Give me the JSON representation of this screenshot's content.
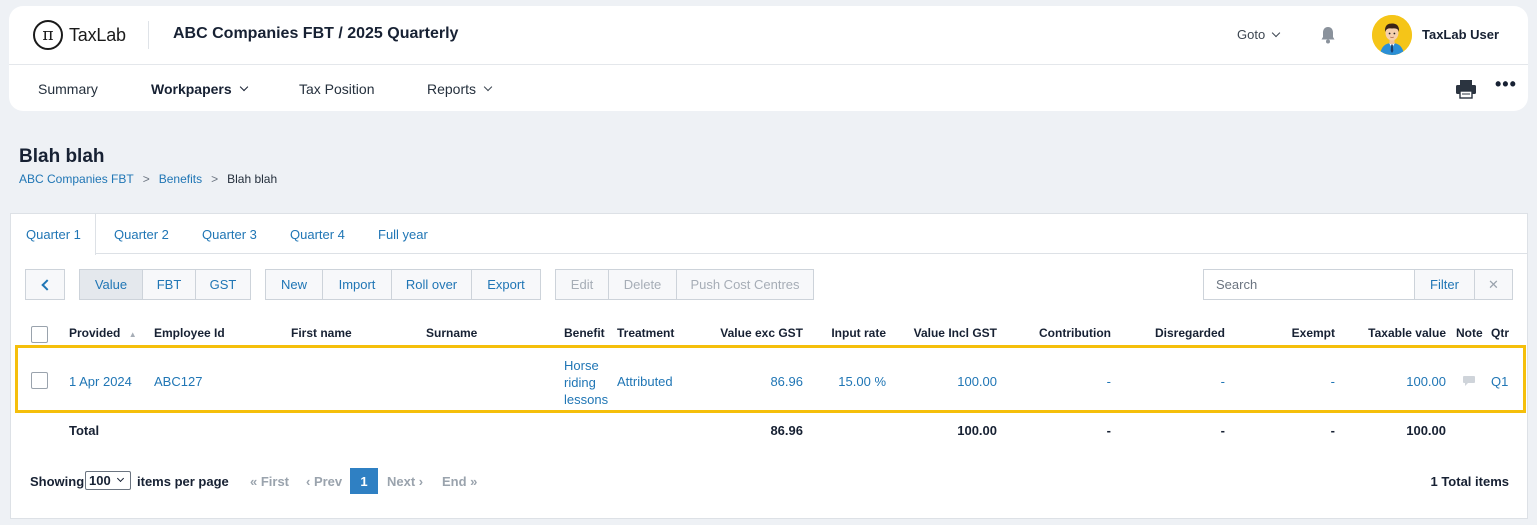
{
  "header": {
    "logo_text": "TaxLab",
    "title": "ABC Companies FBT / 2025 Quarterly",
    "goto_label": "Goto",
    "user_name": "TaxLab User"
  },
  "nav": {
    "items": [
      {
        "label": "Summary",
        "dropdown": false
      },
      {
        "label": "Workpapers",
        "dropdown": true,
        "active": true
      },
      {
        "label": "Tax Position",
        "dropdown": false
      },
      {
        "label": "Reports",
        "dropdown": true
      }
    ]
  },
  "page": {
    "title": "Blah blah",
    "breadcrumb": [
      "ABC Companies FBT",
      "Benefits",
      "Blah blah"
    ],
    "breadcrumb_sep": ">"
  },
  "tabs": [
    "Quarter 1",
    "Quarter 2",
    "Quarter 3",
    "Quarter 4",
    "Full year"
  ],
  "active_tab": "Quarter 1",
  "toolbar": {
    "view_buttons": [
      "Value",
      "FBT",
      "GST"
    ],
    "selected_view": "Value",
    "action_buttons": [
      "New",
      "Import",
      "Roll over",
      "Export"
    ],
    "disabled_buttons": [
      "Edit",
      "Delete",
      "Push Cost Centres"
    ],
    "search_placeholder": "Search",
    "filter_label": "Filter",
    "clear_label": "✕"
  },
  "table": {
    "columns": [
      "Provided",
      "Employee Id",
      "First name",
      "Surname",
      "Benefit",
      "Treatment",
      "Value exc GST",
      "Input rate",
      "Value Incl GST",
      "Contribution",
      "Disregarded",
      "Exempt",
      "Taxable value",
      "Note",
      "Qtr"
    ],
    "sort_column": "Provided",
    "rows": [
      {
        "provided": "1 Apr 2024",
        "employee_id": "ABC127",
        "first_name": "",
        "surname": "",
        "benefit": [
          "Horse",
          "riding",
          "lessons"
        ],
        "treatment": "Attributed",
        "value_exc_gst": "86.96",
        "input_rate": "15.00 %",
        "value_incl_gst": "100.00",
        "contribution": "-",
        "disregarded": "-",
        "exempt": "-",
        "taxable_value": "100.00",
        "qtr": "Q1"
      }
    ],
    "totals": {
      "label": "Total",
      "value_exc_gst": "86.96",
      "value_incl_gst": "100.00",
      "contribution": "-",
      "disregarded": "-",
      "exempt": "-",
      "taxable_value": "100.00"
    }
  },
  "pagination": {
    "showing_label": "Showing",
    "per_page_value": "100",
    "per_page_label": "items per page",
    "first": "« First",
    "prev": "‹ Prev",
    "current": "1",
    "next": "Next ›",
    "end": "End »",
    "total_items": "1 Total items"
  },
  "colors": {
    "accent": "#2076b5",
    "highlight": "#f5bf0b",
    "avatar_bg": "#f5c518",
    "page_bg": "#eef1f5"
  }
}
